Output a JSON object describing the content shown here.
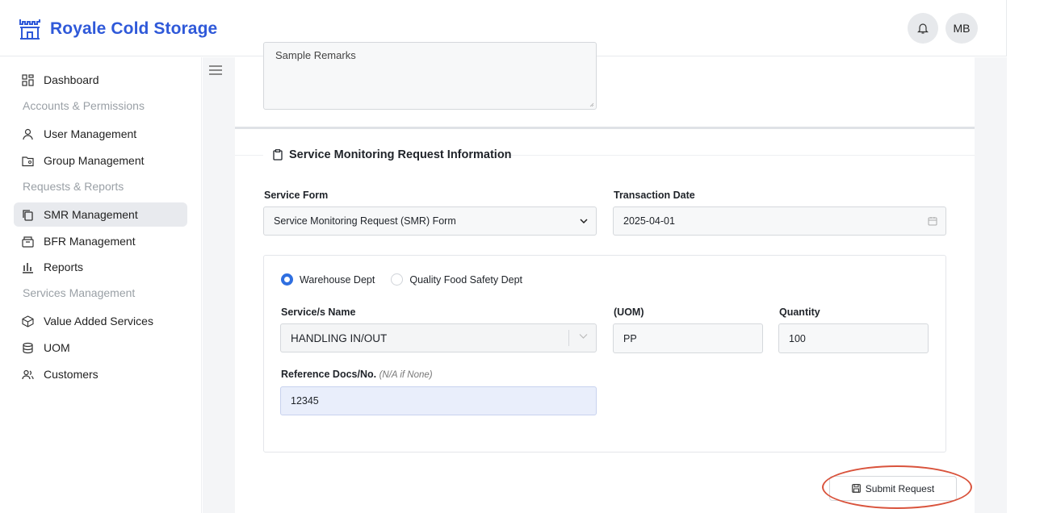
{
  "app": {
    "title": "Royale Cold Storage",
    "brand_color": "#2f59d9",
    "user_initials": "MB"
  },
  "sidebar": {
    "items": [
      {
        "label": "Dashboard",
        "icon": "dashboard-icon"
      },
      {
        "group": "Accounts & Permissions"
      },
      {
        "label": "User Management",
        "icon": "user-icon"
      },
      {
        "label": "Group Management",
        "icon": "folder-group-icon"
      },
      {
        "group": "Requests & Reports"
      },
      {
        "label": "SMR Management",
        "icon": "copy-icon",
        "active": true
      },
      {
        "label": "BFR Management",
        "icon": "archive-icon"
      },
      {
        "label": "Reports",
        "icon": "bar-chart-icon"
      },
      {
        "group": "Services Management"
      },
      {
        "label": "Value Added Services",
        "icon": "box-icon"
      },
      {
        "label": "UOM",
        "icon": "database-icon"
      },
      {
        "label": "Customers",
        "icon": "users-icon"
      }
    ]
  },
  "remarks": {
    "value": "Sample Remarks"
  },
  "form": {
    "section_title": "Service Monitoring Request Information",
    "service_form_label": "Service Form",
    "service_form_value": "Service Monitoring Request (SMR) Form",
    "transaction_date_label": "Transaction Date",
    "transaction_date_value": "2025-04-01",
    "dept_options": [
      {
        "label": "Warehouse Dept",
        "checked": true
      },
      {
        "label": "Quality Food Safety Dept",
        "checked": false
      }
    ],
    "service_name_label": "Service/s Name",
    "service_name_value": "HANDLING IN/OUT",
    "uom_label": "(UOM)",
    "uom_value": "PP",
    "quantity_label": "Quantity",
    "quantity_value": "100",
    "reference_label": "Reference Docs/No.",
    "reference_hint": "(N/A if None)",
    "reference_value": "12345",
    "submit_label": "Submit Request"
  },
  "colors": {
    "accent": "#2f6fe0",
    "highlight": "#d9533c",
    "active_nav_bg": "#e8eaee"
  }
}
